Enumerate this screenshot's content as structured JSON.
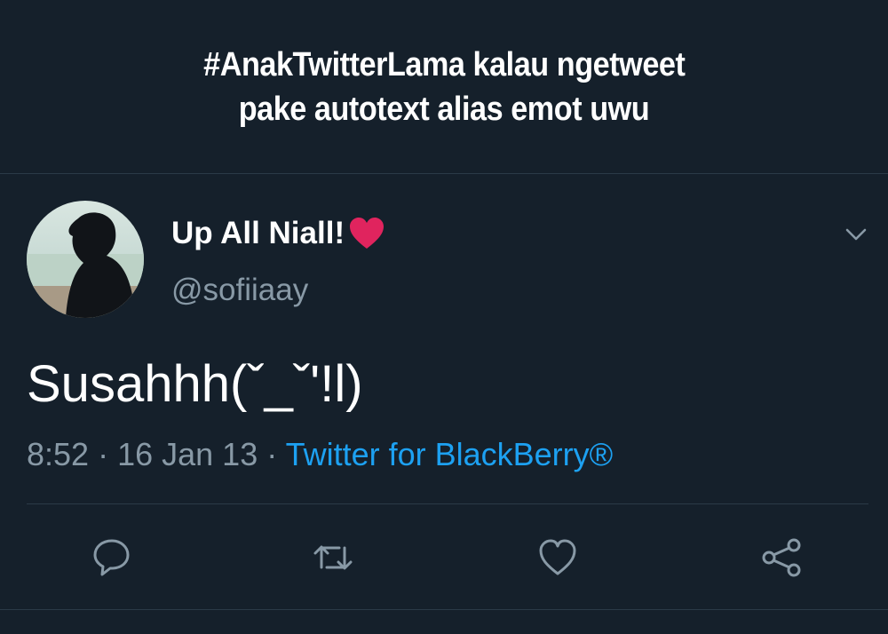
{
  "caption": {
    "line1": "#AnakTwitterLama kalau ngetweet",
    "line2": "pake autotext alias emot uwu"
  },
  "tweet": {
    "display_name": "Up All Niall!",
    "handle": "@sofiiaay",
    "text": "Susahhh(ˇ_ˇ'!l)",
    "time": "8:52",
    "date": "16 Jan 13",
    "separator": " · ",
    "source": "Twitter for BlackBerry®"
  },
  "icons": {
    "name_emoji": "heart-icon",
    "menu": "chevron-down-icon",
    "actions": [
      "reply-icon",
      "retweet-icon",
      "like-icon",
      "share-icon"
    ]
  },
  "colors": {
    "background": "#15202b",
    "text_primary": "#ffffff",
    "text_secondary": "#8899a6",
    "link": "#1da1f2",
    "heart": "#e0245e"
  }
}
